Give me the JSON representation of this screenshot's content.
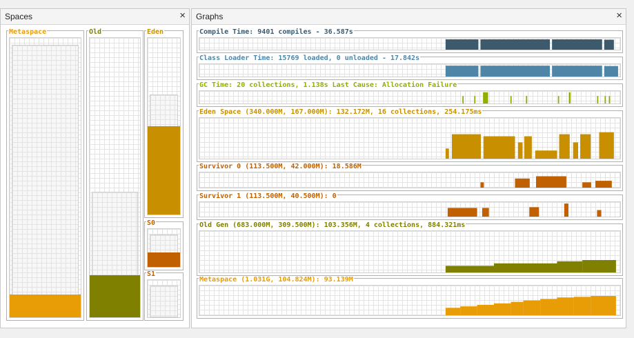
{
  "spaces_tab": {
    "title": "Spaces",
    "close": "×"
  },
  "graphs_tab": {
    "title": "Graphs",
    "close": "×"
  },
  "spaces": [
    {
      "label": "Metaspace",
      "color": "#e89c06",
      "capacity_fraction": 0.97,
      "used_fraction": 0.082
    },
    {
      "label": "Old",
      "color": "#7f7f00",
      "capacity_fraction": 0.445,
      "used_fraction": 0.15
    },
    {
      "label": "Eden",
      "color": "#c89000",
      "capacity_fraction": 0.67,
      "used_fraction": 0.5
    },
    {
      "label": "S0",
      "color": "#c06000",
      "capacity_fraction": 0.82,
      "used_fraction": 0.39
    },
    {
      "label": "S1",
      "color": "#c06000",
      "capacity_fraction": 0.82,
      "used_fraction": 0.0
    }
  ],
  "graphs": [
    {
      "key": "compile",
      "title": "Compile Time: 9401 compiles - 36.587s",
      "color": "#3d5a6c",
      "segments": [
        [
          0.585,
          0.663,
          0.88
        ],
        [
          0.668,
          0.833,
          0.88
        ],
        [
          0.838,
          0.957,
          0.88
        ],
        [
          0.962,
          0.985,
          0.85
        ]
      ]
    },
    {
      "key": "classloader",
      "title": "Class Loader Time: 15769 loaded, 0 unloaded - 17.842s",
      "color": "#4f86a8",
      "segments": [
        [
          0.585,
          0.663,
          0.88
        ],
        [
          0.668,
          0.833,
          0.88
        ],
        [
          0.838,
          0.957,
          0.88
        ],
        [
          0.962,
          0.995,
          0.85
        ]
      ]
    },
    {
      "key": "gc",
      "title": "GC Time: 20 collections, 1.138s  Last Cause: Allocation Failure",
      "color": "#8fb000",
      "segments": [
        [
          0.625,
          0.628,
          0.6
        ],
        [
          0.653,
          0.656,
          0.6
        ],
        [
          0.674,
          0.686,
          0.9
        ],
        [
          0.739,
          0.742,
          0.6
        ],
        [
          0.776,
          0.779,
          0.6
        ],
        [
          0.852,
          0.855,
          0.6
        ],
        [
          0.878,
          0.882,
          0.9
        ],
        [
          0.945,
          0.948,
          0.6
        ],
        [
          0.963,
          0.966,
          0.6
        ],
        [
          0.973,
          0.976,
          0.6
        ]
      ]
    },
    {
      "key": "eden",
      "title": "Eden Space (340.000M, 167.000M): 132.172M, 16 collections, 254.175ms",
      "color": "#c89000",
      "segments": [
        [
          0.585,
          0.593,
          0.25
        ],
        [
          0.6,
          0.669,
          0.6
        ],
        [
          0.675,
          0.75,
          0.55
        ],
        [
          0.757,
          0.768,
          0.4
        ],
        [
          0.772,
          0.79,
          0.55
        ],
        [
          0.798,
          0.85,
          0.2
        ],
        [
          0.855,
          0.88,
          0.6
        ],
        [
          0.888,
          0.9,
          0.4
        ],
        [
          0.905,
          0.93,
          0.6
        ],
        [
          0.95,
          0.985,
          0.65
        ]
      ]
    },
    {
      "key": "s0",
      "title": "Survivor 0 (113.500M, 42.000M): 18.586M",
      "color": "#c06000",
      "segments": [
        [
          0.668,
          0.676,
          0.35
        ],
        [
          0.75,
          0.785,
          0.6
        ],
        [
          0.8,
          0.872,
          0.75
        ],
        [
          0.91,
          0.931,
          0.35
        ],
        [
          0.941,
          0.98,
          0.45
        ]
      ]
    },
    {
      "key": "s1",
      "title": "Survivor 1 (113.500M, 40.500M): 0",
      "color": "#c06000",
      "segments": [
        [
          0.59,
          0.66,
          0.6
        ],
        [
          0.672,
          0.688,
          0.6
        ],
        [
          0.784,
          0.807,
          0.65
        ],
        [
          0.867,
          0.877,
          0.9
        ],
        [
          0.945,
          0.955,
          0.45
        ]
      ]
    },
    {
      "key": "oldgen",
      "title": "Old Gen (683.000M, 309.500M): 103.356M, 4 collections, 884.321ms",
      "color": "#7f7f00",
      "steps": [
        [
          0.585,
          0.7,
          0.16
        ],
        [
          0.7,
          0.85,
          0.22
        ],
        [
          0.85,
          0.91,
          0.27
        ],
        [
          0.91,
          0.99,
          0.3
        ]
      ]
    },
    {
      "key": "meta",
      "title": "Metaspace (1.031G, 104.824M): 93.139M",
      "color": "#e89c06",
      "steps": [
        [
          0.585,
          0.62,
          0.25
        ],
        [
          0.62,
          0.66,
          0.3
        ],
        [
          0.66,
          0.7,
          0.35
        ],
        [
          0.7,
          0.74,
          0.4
        ],
        [
          0.74,
          0.77,
          0.45
        ],
        [
          0.77,
          0.81,
          0.5
        ],
        [
          0.81,
          0.85,
          0.55
        ],
        [
          0.85,
          0.89,
          0.6
        ],
        [
          0.89,
          0.93,
          0.62
        ],
        [
          0.93,
          0.99,
          0.65
        ]
      ]
    }
  ]
}
